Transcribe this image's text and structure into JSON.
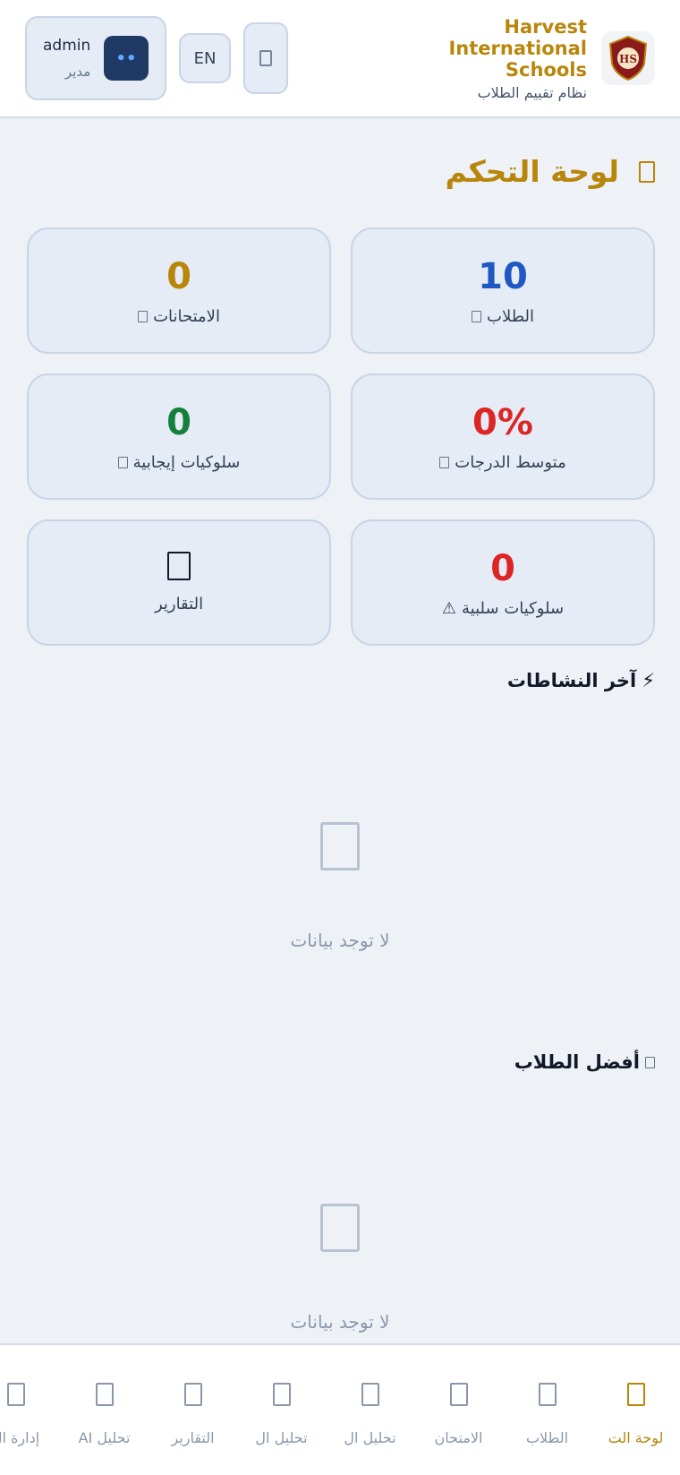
{
  "header": {
    "school_name": "Harvest International Schools",
    "system_name": "نظام تقييم الطلاب",
    "logo_icon": "school-crest-logo",
    "lang_button": "EN",
    "user": {
      "name": "admin",
      "role": "مدير",
      "avatar_text": "••"
    }
  },
  "title": "لوحة التحكم",
  "stats": [
    {
      "value": "10",
      "label": "الطلاب",
      "color": "#1f57c3"
    },
    {
      "value": "0",
      "label": "الامتحانات",
      "color": "#b8860b"
    },
    {
      "value": "0%",
      "label": "متوسط الدرجات",
      "color": "#dc2626"
    },
    {
      "value": "0",
      "label": "سلوكيات إيجابية",
      "color": "#15803d"
    },
    {
      "value": "0",
      "label": "سلوكيات سلبية",
      "color": "#dc2626",
      "prefix": "⚠"
    },
    {
      "value": "",
      "label": "التقارير",
      "color": "#111827"
    }
  ],
  "recent_activity": {
    "title": "آخر النشاطات",
    "empty_text": "لا توجد بيانات"
  },
  "top_students": {
    "title": "أفضل الطلاب",
    "empty_text": "لا توجد بيانات"
  },
  "bottom_nav": [
    {
      "label": "لوحة الت",
      "active": true
    },
    {
      "label": "الطلاب"
    },
    {
      "label": "الامتحان"
    },
    {
      "label": "تحليل ال"
    },
    {
      "label": "تحليل ال"
    },
    {
      "label": "التقارير"
    },
    {
      "label": "تحليل AI"
    },
    {
      "label": "إدارة ال"
    }
  ]
}
